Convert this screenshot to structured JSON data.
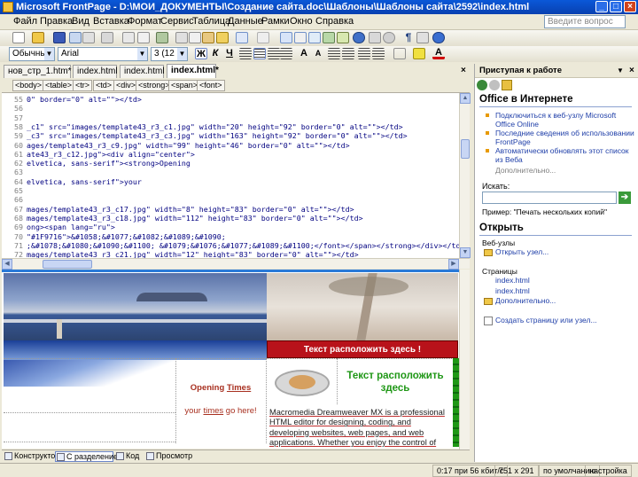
{
  "window": {
    "title": "Microsoft FrontPage - D:\\МОИ_ДОКУМЕНТЫ\\Создание сайта.doc\\Шаблоны\\Шаблоны сайта\\2592\\index.html"
  },
  "menu": [
    "Файл",
    "Правка",
    "Вид",
    "Вставка",
    "Формат",
    "Сервис",
    "Таблица",
    "Данные",
    "Рамки",
    "Окно",
    "Справка"
  ],
  "help_placeholder": "Введите вопрос",
  "toolbar": {
    "style": "Обычный",
    "font": "Arial",
    "size": "3 (12 пт)"
  },
  "tabs": [
    "нов_стр_1.htm*",
    "index.html",
    "index.html",
    "index.html*"
  ],
  "tags": [
    "<body>",
    "<table>",
    "<tr>",
    "<td>",
    "<div>",
    "<strong>",
    "<span>",
    "<font>"
  ],
  "code_lines": [
    {
      "n": "55",
      "t": "0\" border=\"0\" alt=\"\"></td>"
    },
    {
      "n": "56",
      "t": ""
    },
    {
      "n": "57",
      "t": ""
    },
    {
      "n": "58",
      "t": "_c1\" src=\"images/template43_r3_c1.jpg\" width=\"20\" height=\"92\" border=\"0\" alt=\"\"></td>"
    },
    {
      "n": "59",
      "t": "_c3\" src=\"images/template43_r3_c3.jpg\" width=\"163\" height=\"92\" border=\"0\" alt=\"\"></td>"
    },
    {
      "n": "60",
      "t": "ages/template43_r3_c9.jpg\" width=\"99\" height=\"46\" border=\"0\" alt=\"\"></td>"
    },
    {
      "n": "61",
      "t": "ate43_r3_c12.jpg\"><div align=\"center\">"
    },
    {
      "n": "62",
      "t": "elvetica, sans-serif\"><strong>Opening"
    },
    {
      "n": "63",
      "t": ""
    },
    {
      "n": "64",
      "t": "elvetica, sans-serif\">your"
    },
    {
      "n": "65",
      "t": ""
    },
    {
      "n": "66",
      "t": ""
    },
    {
      "n": "67",
      "t": "mages/template43_r3_c17.jpg\" width=\"8\" height=\"83\" border=\"0\" alt=\"\"></td>"
    },
    {
      "n": "68",
      "t": "mages/template43_r3_c18.jpg\" width=\"112\" height=\"83\" border=\"0\" alt=\"\"></td>"
    },
    {
      "n": "69",
      "t": "ong><span lang=\"ru\">"
    },
    {
      "n": "70",
      "t": "\"#1F9716\">&#1058;&#1077;&#1082;&#1089;&#1090;"
    },
    {
      "n": "71",
      "t": ";&#1078;&#1080;&#1090;&#1100; &#1079;&#1076;&#1077;&#1089;&#1100;</font></span></strong></div></td>"
    },
    {
      "n": "72",
      "t": "mages/template43_r3_c21.jpg\" width=\"12\" height=\"83\" border=\"0\" alt=\"\"></td>"
    }
  ],
  "design": {
    "red_banner": "Текст расположить здесь !",
    "green_heading": "Текст расположить здесь",
    "opening_bold": "Opening",
    "opening_times": "Times",
    "your": "your",
    "times": "times",
    "go_here": "go here!",
    "para": "Macromedia Dreamweaver MX is a professional HTML editor for designing, coding, and developing websites, web pages, and web applications. Whether you enjoy the control of hand-coding"
  },
  "views": [
    "Конструктор",
    "С разделением",
    "Код",
    "Просмотр"
  ],
  "status": [
    "0:17 при 56 кбит/с",
    "751 x 291",
    "по умолчанию",
    "настройка"
  ],
  "task_pane": {
    "title": "Приступая к работе",
    "office_title": "Office в Интернете",
    "links": [
      "Подключиться к веб-узлу Microsoft Office Online",
      "Последние сведения об использовании FrontPage",
      "Автоматически обновлять этот список из Веба"
    ],
    "more": "Дополнительно...",
    "search_label": "Искать:",
    "example": "Пример: \"Печать нескольких копий\"",
    "open_title": "Открыть",
    "websites_label": "Веб-узлы",
    "open_site": "Открыть узел...",
    "pages_label": "Страницы",
    "pages": [
      "index.html",
      "index.html"
    ],
    "more2": "Дополнительно...",
    "create": "Создать страницу или узел..."
  },
  "colors": {
    "title_blue": "#0a58d8",
    "banner_red": "#b8121a",
    "green_text": "#1f9716",
    "opening_red": "#a83020"
  }
}
